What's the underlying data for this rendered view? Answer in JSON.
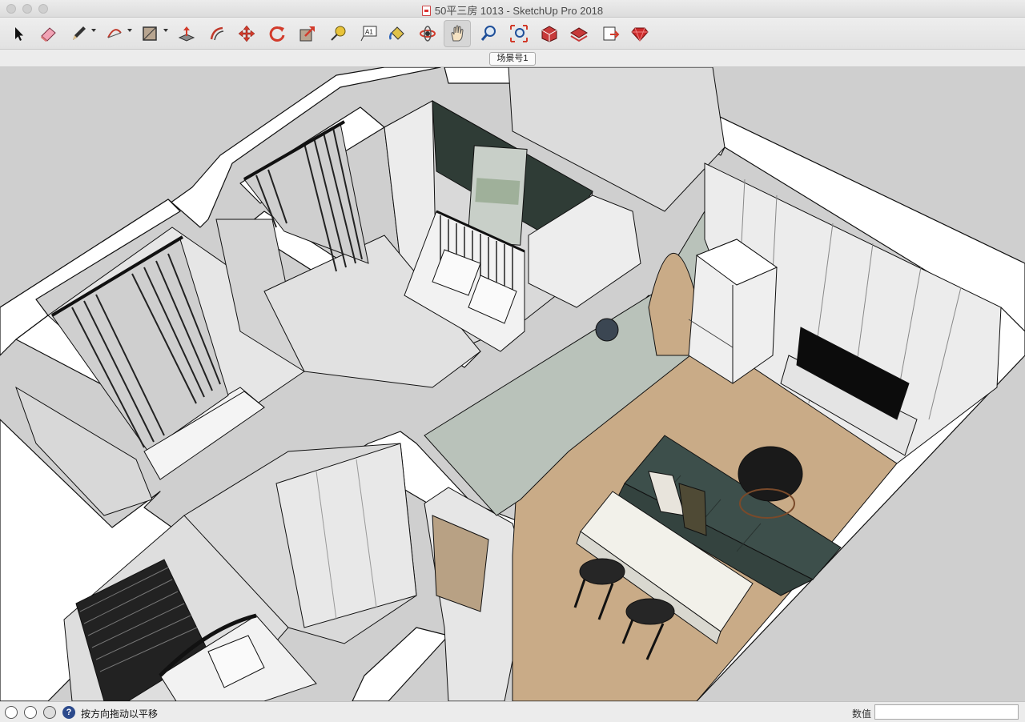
{
  "window": {
    "title": "50平三房 1013 - SketchUp Pro 2018"
  },
  "toolbar": {
    "tools": [
      {
        "name": "select-tool",
        "icon": "arrow-cursor-icon"
      },
      {
        "name": "eraser-tool",
        "icon": "eraser-icon"
      },
      {
        "name": "line-tool",
        "icon": "pencil-icon",
        "dropdown": true
      },
      {
        "name": "arc-tool",
        "icon": "arc-icon",
        "dropdown": true
      },
      {
        "name": "rectangle-tool",
        "icon": "rectangle-icon",
        "dropdown": true
      },
      {
        "name": "push-pull-tool",
        "icon": "push-pull-icon"
      },
      {
        "name": "offset-tool",
        "icon": "offset-icon"
      },
      {
        "name": "move-tool",
        "icon": "move-icon"
      },
      {
        "name": "rotate-tool",
        "icon": "rotate-icon"
      },
      {
        "name": "scale-tool",
        "icon": "scale-icon"
      },
      {
        "name": "tape-measure-tool",
        "icon": "tape-measure-icon"
      },
      {
        "name": "text-tool",
        "icon": "text-icon"
      },
      {
        "name": "paint-bucket-tool",
        "icon": "paint-bucket-icon"
      },
      {
        "name": "orbit-tool",
        "icon": "orbit-icon"
      },
      {
        "name": "pan-tool",
        "icon": "hand-icon",
        "active": true
      },
      {
        "name": "zoom-tool",
        "icon": "magnifier-icon"
      },
      {
        "name": "zoom-extents-tool",
        "icon": "zoom-extents-icon"
      },
      {
        "name": "3d-warehouse-tool",
        "icon": "warehouse-icon"
      },
      {
        "name": "extension-warehouse-tool",
        "icon": "extension-warehouse-icon"
      },
      {
        "name": "layout-tool",
        "icon": "layout-icon"
      },
      {
        "name": "ruby-console-tool",
        "icon": "ruby-icon"
      }
    ],
    "text_tool_glyph": "A1"
  },
  "scenes": {
    "tabs": [
      {
        "label": "场景号1"
      }
    ]
  },
  "status": {
    "message": "按方向拖动以平移",
    "measurements_label": "数值",
    "measurements_value": ""
  },
  "colors": {
    "viewport_bg": "#cfcfcf",
    "wall_top": "#ffffff",
    "wall_face": "#dedede",
    "floor_wood": "#c7aa88",
    "accent_wall": "#2f3c36",
    "sofa": "#3d4f4b",
    "sage_wall": "#b9c2ba"
  }
}
